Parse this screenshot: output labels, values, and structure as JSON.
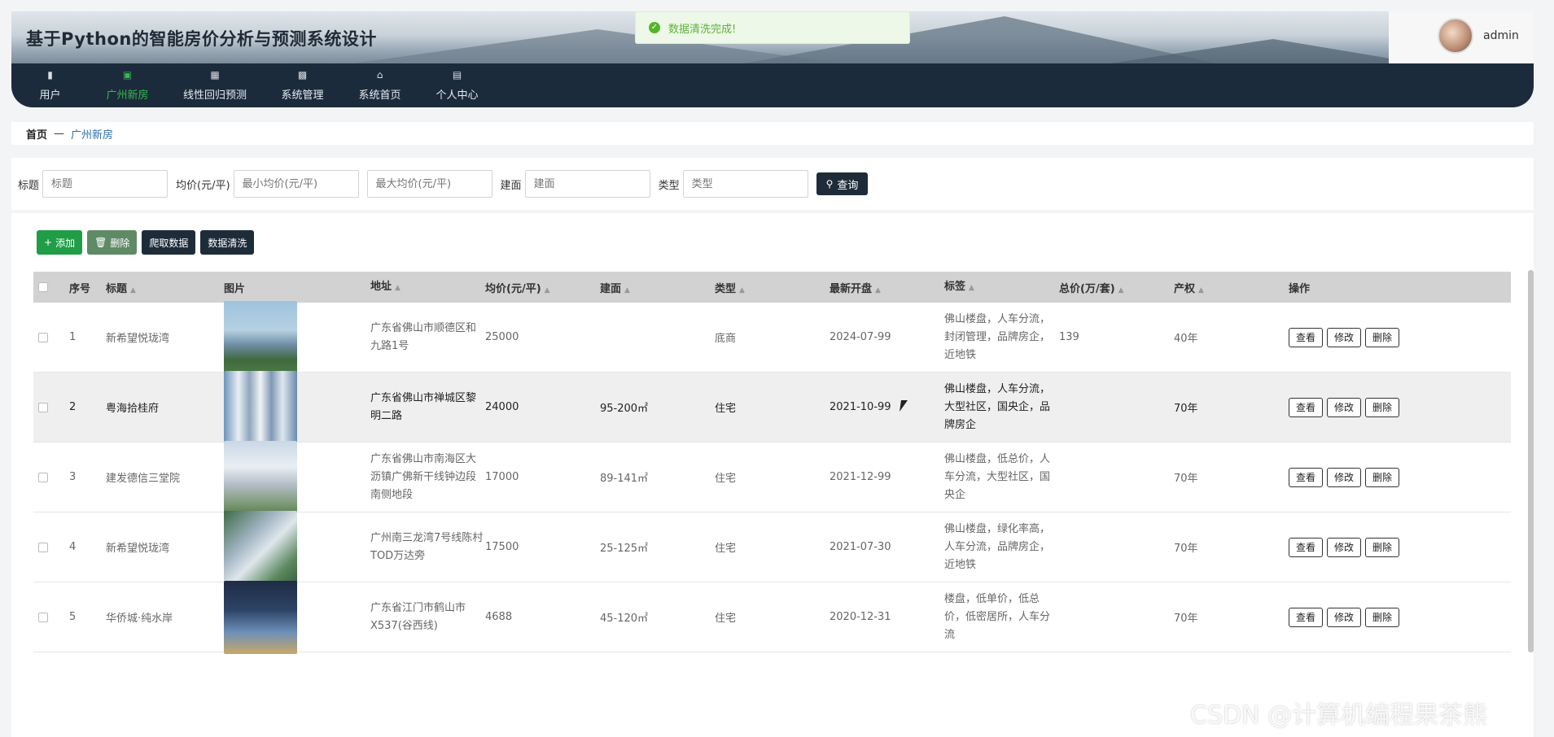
{
  "header": {
    "title": "基于Python的智能房价分析与预测系统设计",
    "username": "admin"
  },
  "nav": [
    {
      "label": "用户",
      "icon": "briefcase-icon"
    },
    {
      "label": "广州新房",
      "icon": "check-square-icon"
    },
    {
      "label": "线性回归预测",
      "icon": "grid-icon"
    },
    {
      "label": "系统管理",
      "icon": "bar-chart-icon"
    },
    {
      "label": "系统首页",
      "icon": "home-icon"
    },
    {
      "label": "个人中心",
      "icon": "window-icon"
    }
  ],
  "toast": {
    "message": "数据清洗完成!",
    "color": "#52b52a"
  },
  "breadcrumb": {
    "home": "首页",
    "separator": "—",
    "current": "广州新房"
  },
  "search": {
    "title_label": "标题",
    "title_placeholder": "标题",
    "price_label": "均价(元/平)",
    "min_price_placeholder": "最小均价(元/平)",
    "max_price_placeholder": "最大均价(元/平)",
    "area_label": "建面",
    "area_placeholder": "建面",
    "type_label": "类型",
    "type_placeholder": "类型",
    "query_button": "查询"
  },
  "toolbar": {
    "add": "添加",
    "delete": "删除",
    "crawl": "爬取数据",
    "clean": "数据清洗"
  },
  "table": {
    "columns": [
      "序号",
      "标题",
      "图片",
      "地址",
      "均价(元/平)",
      "建面",
      "类型",
      "最新开盘",
      "标签",
      "总价(万/套)",
      "产权",
      "操作"
    ],
    "rows": [
      {
        "index": "1",
        "title": "新希望悦珑湾",
        "address": "广东省佛山市顺德区和九路1号",
        "price": "25000",
        "area": "",
        "type": "底商",
        "open_date": "2024-07-99",
        "tags": "佛山楼盘，人车分流，封闭管理，品牌房企，近地铁",
        "total": "139",
        "property": "40年"
      },
      {
        "index": "2",
        "title": "粤海拾桂府",
        "address": "广东省佛山市禅城区黎明二路",
        "price": "24000",
        "area": "95-200㎡",
        "type": "住宅",
        "open_date": "2021-10-99",
        "tags": "佛山楼盘，人车分流，大型社区，国央企，品牌房企",
        "total": "",
        "property": "70年"
      },
      {
        "index": "3",
        "title": "建发德信三堂院",
        "address": "广东省佛山市南海区大沥镇广佛新干线钟边段南侧地段",
        "price": "17000",
        "area": "89-141㎡",
        "type": "住宅",
        "open_date": "2021-12-99",
        "tags": "佛山楼盘，低总价，人车分流，大型社区，国央企",
        "total": "",
        "property": "70年"
      },
      {
        "index": "4",
        "title": "新希望悦珑湾",
        "address": "广州南三龙湾7号线陈村TOD万达旁",
        "price": "17500",
        "area": "25-125㎡",
        "type": "住宅",
        "open_date": "2021-07-30",
        "tags": "佛山楼盘，绿化率高，人车分流，品牌房企，近地铁",
        "total": "",
        "property": "70年"
      },
      {
        "index": "5",
        "title": "华侨城·纯水岸",
        "address": "广东省江门市鹤山市X537(谷西线)",
        "price": "4688",
        "area": "45-120㎡",
        "type": "住宅",
        "open_date": "2020-12-31",
        "tags": "楼盘，低单价，低总价，低密居所，人车分流",
        "total": "",
        "property": "70年"
      }
    ],
    "actions": {
      "view": "查看",
      "edit": "修改",
      "delete": "删除"
    }
  },
  "watermark": "CSDN @计算机编程果茶熊"
}
